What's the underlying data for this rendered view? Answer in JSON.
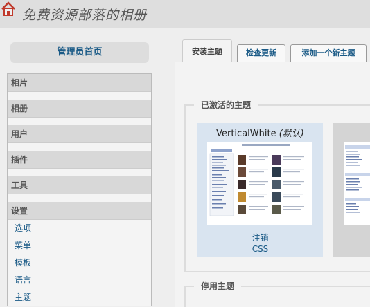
{
  "header": {
    "title": "免费资源部落的相册",
    "home_icon": "home-icon"
  },
  "sidebar": {
    "admin_home": "管理员首页",
    "sections": [
      {
        "label": "相片"
      },
      {
        "label": "相册"
      },
      {
        "label": "用户"
      },
      {
        "label": "插件"
      },
      {
        "label": "工具"
      },
      {
        "label": "设置",
        "items": [
          "选项",
          "菜单",
          "模板",
          "语言",
          "主题"
        ]
      }
    ]
  },
  "tabs": [
    "安装主题",
    "检查更新",
    "添加一个新主题"
  ],
  "active_themes": {
    "legend": "已激活的主题",
    "theme_name": "VerticalWhite",
    "default_label": "(默认)",
    "action": "注销",
    "css_link": "CSS"
  },
  "inactive_themes": {
    "legend": "停用主题"
  },
  "colors": {
    "link": "#1a5a86",
    "card_bg": "#d9e4f0"
  }
}
